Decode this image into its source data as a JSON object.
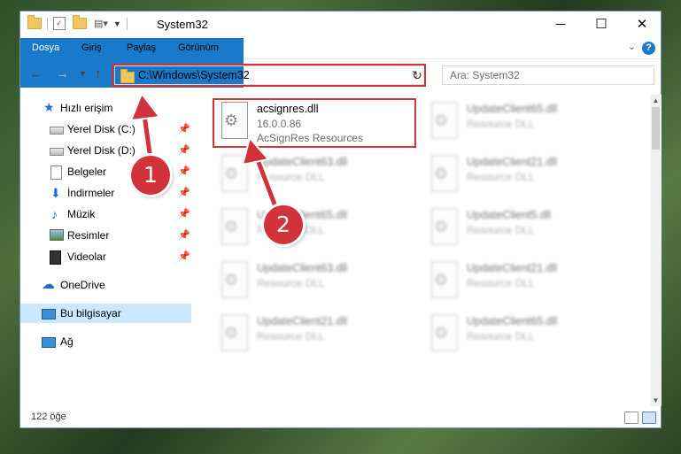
{
  "window": {
    "title": "System32",
    "controls": {
      "minimize": "─",
      "maximize": "☐",
      "close": "✕"
    }
  },
  "ribbon": {
    "tabs": [
      "Dosya",
      "Giriş",
      "Paylaş",
      "Görünüm"
    ],
    "help": "?"
  },
  "nav": {
    "address_path": "C:\\Windows\\System32",
    "search_placeholder": "Ara: System32"
  },
  "sidebar": {
    "quick_access": "Hızlı erişim",
    "items": [
      {
        "label": "Yerel Disk (C:)",
        "icon": "drive-icon",
        "pinned": true
      },
      {
        "label": "Yerel Disk (D:)",
        "icon": "drive-icon",
        "pinned": true
      },
      {
        "label": "Belgeler",
        "icon": "documents-icon",
        "pinned": true
      },
      {
        "label": "İndirmeler",
        "icon": "downloads-icon",
        "pinned": true
      },
      {
        "label": "Müzik",
        "icon": "music-icon",
        "pinned": true
      },
      {
        "label": "Resimler",
        "icon": "pictures-icon",
        "pinned": true
      },
      {
        "label": "Videolar",
        "icon": "videos-icon",
        "pinned": true
      }
    ],
    "onedrive": "OneDrive",
    "this_pc": "Bu bilgisayar",
    "network": "Ağ"
  },
  "files": {
    "highlighted": {
      "name": "acsignres.dll",
      "version": "16.0.0.86",
      "description": "AcSignRes Resources"
    },
    "blurred": [
      {
        "name": "UpdateClient65.dll",
        "type": "Resource DLL"
      },
      {
        "name": "UpdateClient63.dll",
        "type": "Resource DLL"
      },
      {
        "name": "UpdateClient21.dll",
        "type": "Resource DLL"
      },
      {
        "name": "UpdateClient65.dll",
        "type": "Resource DLL"
      },
      {
        "name": "UpdateClient5.dll",
        "type": "Resource DLL"
      },
      {
        "name": "UpdateClient63.dll",
        "type": "Resource DLL"
      },
      {
        "name": "UpdateClient21.dll",
        "type": "Resource DLL"
      },
      {
        "name": "UpdateClient21.dll",
        "type": "Resource DLL"
      },
      {
        "name": "UpdateClient65.dll",
        "type": "Resource DLL"
      }
    ]
  },
  "status": {
    "item_count": "122 öğe"
  },
  "callouts": {
    "step1": "1",
    "step2": "2"
  },
  "colors": {
    "accent": "#1979ca",
    "highlight": "#d2323a",
    "selected_bg": "#cce8ff"
  }
}
